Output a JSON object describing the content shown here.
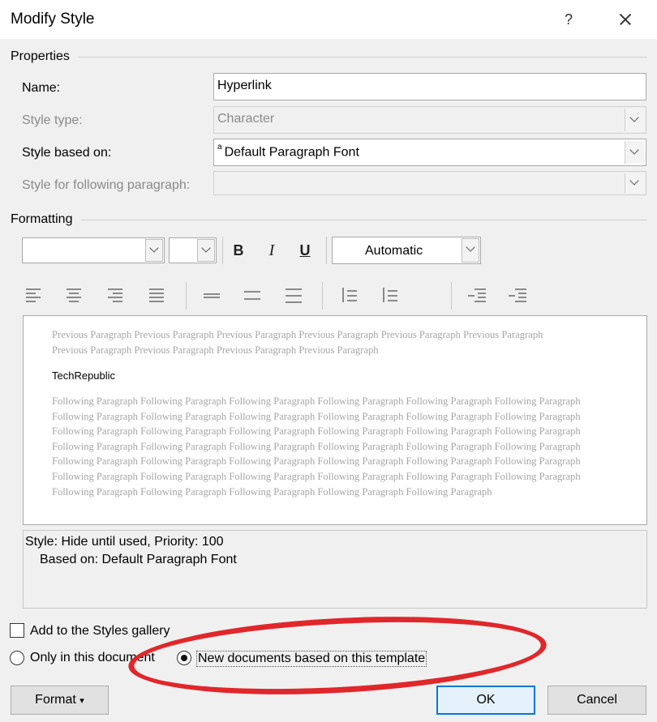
{
  "window": {
    "title": "Modify Style",
    "help_glyph": "?"
  },
  "properties": {
    "section_label": "Properties",
    "name_label": "Name:",
    "name_value": "Hyperlink",
    "style_type_label": "Style type:",
    "style_type_value": "Character",
    "based_on_label": "Style based on:",
    "based_on_prefix": "a",
    "based_on_value": "Default Paragraph Font",
    "following_label": "Style for following paragraph:",
    "following_value": ""
  },
  "formatting": {
    "section_label": "Formatting",
    "font_value": "",
    "size_value": "",
    "bold_glyph": "B",
    "italic_glyph": "I",
    "underline_glyph": "U",
    "color_value": "Automatic"
  },
  "preview": {
    "previous_text": "Previous Paragraph Previous Paragraph Previous Paragraph Previous Paragraph Previous Paragraph Previous Paragraph Previous Paragraph Previous Paragraph Previous Paragraph Previous Paragraph",
    "sample_text": "TechRepublic",
    "following_text": "Following Paragraph Following Paragraph Following Paragraph Following Paragraph Following Paragraph Following Paragraph Following Paragraph Following Paragraph Following Paragraph Following Paragraph Following Paragraph Following Paragraph Following Paragraph Following Paragraph Following Paragraph Following Paragraph Following Paragraph Following Paragraph Following Paragraph Following Paragraph Following Paragraph Following Paragraph Following Paragraph Following Paragraph Following Paragraph Following Paragraph Following Paragraph Following Paragraph Following Paragraph Following Paragraph Following Paragraph Following Paragraph Following Paragraph Following Paragraph Following Paragraph Following Paragraph Following Paragraph Following Paragraph Following Paragraph Following Paragraph Following Paragraph"
  },
  "description": {
    "line1": "Style: Hide until used, Priority: 100",
    "line2": "Based on: Default Paragraph Font"
  },
  "options": {
    "add_to_gallery_label": "Add to the Styles gallery",
    "only_this_doc_label": "Only in this document",
    "new_docs_label": "New documents based on this template",
    "selected": "new_docs"
  },
  "buttons": {
    "format_label": "Format",
    "format_arrow": "▾",
    "ok_label": "OK",
    "cancel_label": "Cancel"
  },
  "colors": {
    "highlight_oval": "#e0272a",
    "ok_border": "#0078d7"
  }
}
